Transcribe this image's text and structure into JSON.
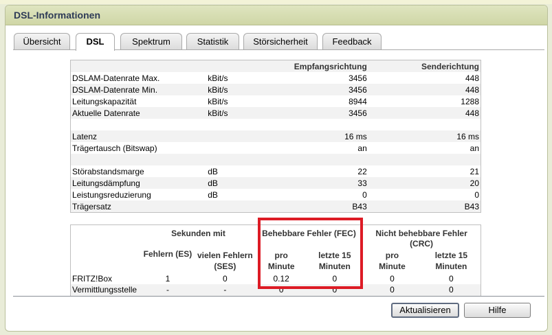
{
  "window": {
    "title": "DSL-Informationen"
  },
  "tabs": [
    "Übersicht",
    "DSL",
    "Spektrum",
    "Statistik",
    "Störsicherheit",
    "Feedback"
  ],
  "active_tab": "DSL",
  "line_table": {
    "headers": {
      "down": "Empfangsrichtung",
      "up": "Senderichtung"
    },
    "rows": [
      {
        "label": "DSLAM-Datenrate Max.",
        "unit": "kBit/s",
        "down": "3456",
        "up": "448"
      },
      {
        "label": "DSLAM-Datenrate Min.",
        "unit": "kBit/s",
        "down": "3456",
        "up": "448"
      },
      {
        "label": "Leitungskapazität",
        "unit": "kBit/s",
        "down": "8944",
        "up": "1288"
      },
      {
        "label": "Aktuelle Datenrate",
        "unit": "kBit/s",
        "down": "3456",
        "up": "448"
      },
      {
        "label": "",
        "unit": "",
        "down": "",
        "up": ""
      },
      {
        "label": "Latenz",
        "unit": "",
        "down": "16 ms",
        "up": "16 ms"
      },
      {
        "label": "Trägertausch (Bitswap)",
        "unit": "",
        "down": "an",
        "up": "an"
      },
      {
        "label": "",
        "unit": "",
        "down": "",
        "up": ""
      },
      {
        "label": "Störabstandsmarge",
        "unit": "dB",
        "down": "22",
        "up": "21"
      },
      {
        "label": "Leitungsdämpfung",
        "unit": "dB",
        "down": "33",
        "up": "20"
      },
      {
        "label": "Leistungsreduzierung",
        "unit": "dB",
        "down": "0",
        "up": "0"
      },
      {
        "label": "Trägersatz",
        "unit": "",
        "down": "B43",
        "up": "B43"
      }
    ]
  },
  "error_table": {
    "group_headers": {
      "seconds": "Sekunden mit",
      "fec": "Behebbare Fehler (FEC)",
      "crc": "Nicht behebbare Fehler (CRC)"
    },
    "sub_headers": {
      "es": "Fehlern (ES)",
      "ses": "vielen Fehlern (SES)",
      "fec_min": "pro Minute",
      "fec_15": "letzte 15 Minuten",
      "crc_min": "pro Minute",
      "crc_15": "letzte 15 Minuten"
    },
    "rows": [
      {
        "label": "FRITZ!Box",
        "es": "1",
        "ses": "0",
        "fec_min": "0.12",
        "fec_15": "0",
        "crc_min": "0",
        "crc_15": "0"
      },
      {
        "label": "Vermittlungsstelle",
        "es": "-",
        "ses": "-",
        "fec_min": "0",
        "fec_15": "0",
        "crc_min": "0",
        "crc_15": "0"
      }
    ]
  },
  "highlight": {
    "color": "#dd1b25",
    "target": "Behebbare Fehler (FEC)"
  },
  "buttons": {
    "refresh": "Aktualisieren",
    "help": "Hilfe"
  }
}
